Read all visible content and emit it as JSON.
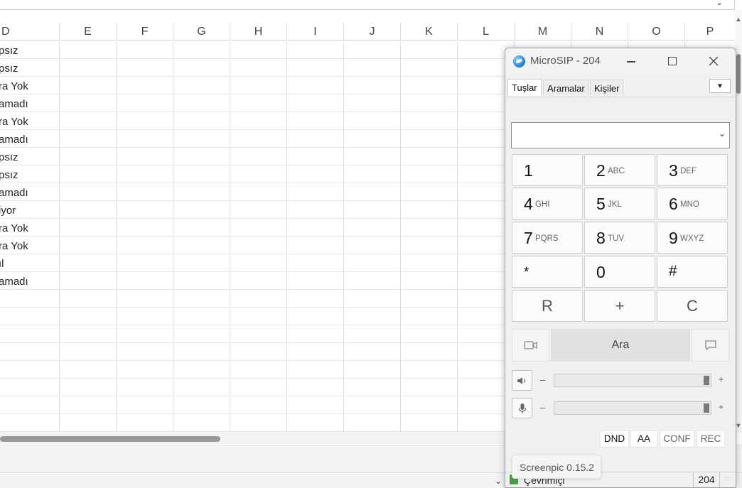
{
  "spreadsheet": {
    "columns": [
      "D",
      "E",
      "F",
      "G",
      "H",
      "I",
      "J",
      "K",
      "L",
      "M",
      "N",
      "O",
      "P"
    ],
    "column_d_cells": [
      "psız",
      "psız",
      "ra Yok",
      "amadı",
      "ra Yok",
      "amadı",
      "psız",
      "psız",
      "amadı",
      "iyor",
      "ra Yok",
      "ra Yok",
      "ıl",
      "amadı",
      "",
      "",
      "",
      "",
      "",
      "",
      "",
      ""
    ]
  },
  "microsip": {
    "title": "MicroSIP - 204",
    "tabs": [
      {
        "label": "Tuşlar",
        "active": true
      },
      {
        "label": "Aramalar",
        "active": false
      },
      {
        "label": "Kişiler",
        "active": false
      }
    ],
    "dial_value": "",
    "keypad": [
      {
        "num": "1",
        "letters": ""
      },
      {
        "num": "2",
        "letters": "ABC"
      },
      {
        "num": "3",
        "letters": "DEF"
      },
      {
        "num": "4",
        "letters": "GHI"
      },
      {
        "num": "5",
        "letters": "JKL"
      },
      {
        "num": "6",
        "letters": "MNO"
      },
      {
        "num": "7",
        "letters": "PQRS"
      },
      {
        "num": "8",
        "letters": "TUV"
      },
      {
        "num": "9",
        "letters": "WXYZ"
      },
      {
        "num": "*",
        "letters": ""
      },
      {
        "num": "0",
        "letters": ""
      },
      {
        "num": "#",
        "letters": ""
      },
      {
        "num": "R",
        "letters": ""
      },
      {
        "num": "+",
        "letters": ""
      },
      {
        "num": "C",
        "letters": ""
      }
    ],
    "call_label": "Ara",
    "speaker": {
      "minus": "–",
      "plus": "+",
      "level": 1.0
    },
    "microphone": {
      "minus": "–",
      "plus": "+",
      "level": 1.0
    },
    "mode_buttons": [
      "DND",
      "AA",
      "CONF",
      "REC"
    ],
    "status_text": "Çevrimiçi",
    "extension": "204"
  },
  "tooltip": "Screenpic 0.15.2"
}
